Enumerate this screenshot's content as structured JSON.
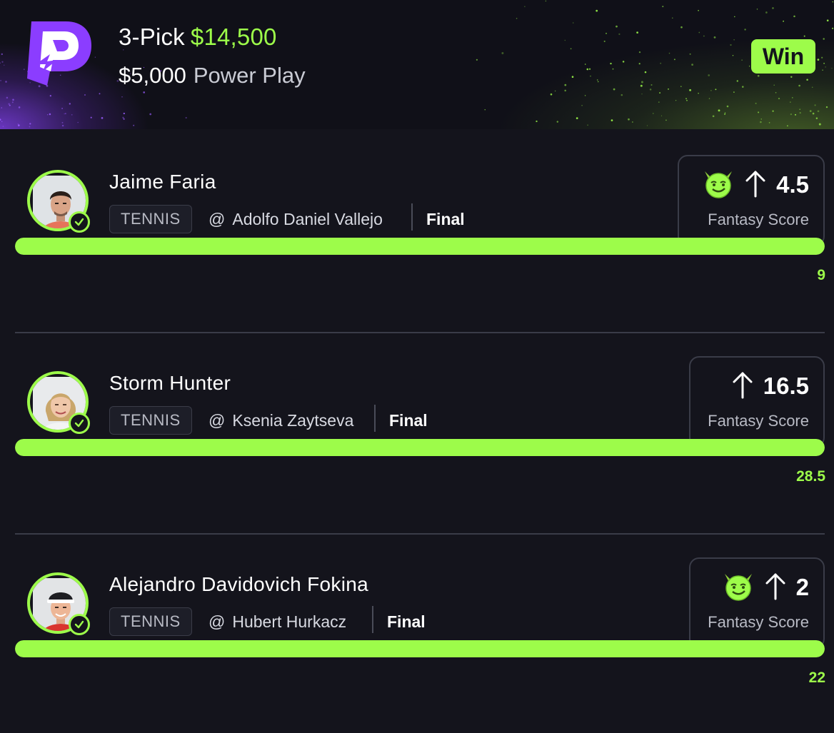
{
  "header": {
    "pick_count": "3-Pick",
    "prize": "$14,500",
    "entry_amount": "$5,000",
    "play_type": "Power Play",
    "result_badge": "Win",
    "logo_icon": "prizepicks-logo-icon"
  },
  "colors": {
    "accent_green": "#9dfc4a",
    "brand_purple": "#8b3dff",
    "background": "#14141c",
    "card_border": "#3a3c48"
  },
  "picks": [
    {
      "player": "Jaime Faria",
      "sport": "TENNIS",
      "opponent_prefix": "@",
      "opponent": "Adolfo Daniel Vallejo",
      "status": "Final",
      "demon_icon": true,
      "direction_icon": "arrow-up-icon",
      "line": "4.5",
      "stat": "Fantasy Score",
      "actual": "9",
      "progress": 1.0
    },
    {
      "player": "Storm Hunter",
      "sport": "TENNIS",
      "opponent_prefix": "@",
      "opponent": "Ksenia Zaytseva",
      "status": "Final",
      "demon_icon": false,
      "direction_icon": "arrow-up-icon",
      "line": "16.5",
      "stat": "Fantasy Score",
      "actual": "28.5",
      "progress": 1.0
    },
    {
      "player": "Alejandro Davidovich Fokina",
      "sport": "TENNIS",
      "opponent_prefix": "@",
      "opponent": "Hubert Hurkacz",
      "status": "Final",
      "demon_icon": true,
      "direction_icon": "arrow-up-icon",
      "line": "2",
      "stat": "Fantasy Score",
      "actual": "22",
      "progress": 1.0
    }
  ]
}
